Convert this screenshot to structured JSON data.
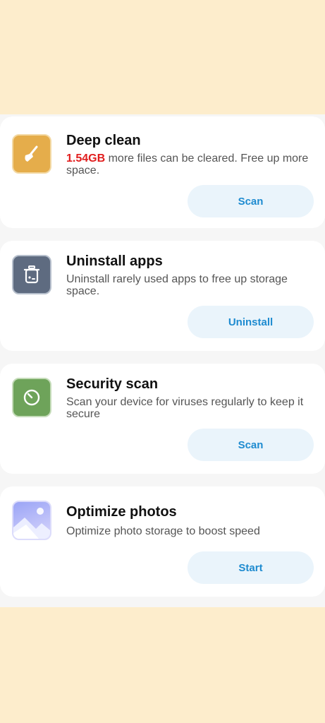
{
  "cards": [
    {
      "title": "Deep clean",
      "highlight": "1.54GB",
      "desc_rest": " more files can be cleared. Free up more space.",
      "button": "Scan",
      "icon": "broom-icon",
      "icon_color": "#e5ad4b"
    },
    {
      "title": "Uninstall apps",
      "desc": "Uninstall rarely used apps to free up storage space.",
      "button": "Uninstall",
      "icon": "trash-box-icon",
      "icon_color": "#5e6b80"
    },
    {
      "title": "Security scan",
      "desc": "Scan your device for viruses regularly to keep it secure",
      "button": "Scan",
      "icon": "timer-shield-icon",
      "icon_color": "#6ea35a"
    },
    {
      "title": "Optimize photos",
      "desc": "Optimize photo storage to boost speed",
      "button": "Start",
      "icon": "photo-icon",
      "icon_color": "#b7b7f3"
    }
  ],
  "colors": {
    "top_background": "#fdedcc",
    "card_background": "#ffffff",
    "button_background": "#eaf4fb",
    "button_text": "#1e8bd0",
    "highlight_text": "#e11d1d"
  }
}
